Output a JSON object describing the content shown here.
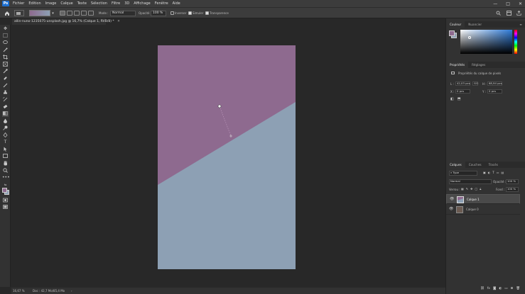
{
  "menubar": {
    "logo": "Ps",
    "items": [
      "Fichier",
      "Edition",
      "Image",
      "Calque",
      "Texte",
      "Sélection",
      "Filtre",
      "3D",
      "Affichage",
      "Fenêtre",
      "Aide"
    ],
    "window_controls": [
      "—",
      "□",
      "✕"
    ]
  },
  "options": {
    "mode_label": "Mode :",
    "mode_value": "Normal",
    "opacity_label": "Opacité :",
    "opacity_value": "100 %",
    "inverse_label": "Inverser",
    "simulate_label": "Simuler",
    "transparency_label": "Transparence"
  },
  "document": {
    "tab_title": "allin-nuno-1235075-unsplash.jpg @ 16,7% (Calque 1, RVB/8) *",
    "gradient_colors": {
      "pink": "#8e6a8f",
      "blue": "#8da0b4"
    }
  },
  "status": {
    "zoom": "16,67 %",
    "doc_size": "Doc : 42,7 Mo/85,4 Mo"
  },
  "color_panel": {
    "tabs": [
      "Couleur",
      "Nuancier"
    ],
    "foreground": "#8e6a8f",
    "background": "#8da0b4"
  },
  "properties_panel": {
    "tabs": [
      "Propriétés",
      "Réglages"
    ],
    "title": "Propriétés du calque de pixels",
    "l_label": "L :",
    "l_value": "42,03 pcs",
    "go_label": "GO",
    "h_label": "H :",
    "h_value": "68,94 pcs",
    "x_label": "X :",
    "x_value": "0 pcs",
    "y_label": "Y :",
    "y_value": "0 pcs"
  },
  "layers_panel": {
    "tabs": [
      "Calques",
      "Couches",
      "Tracés"
    ],
    "filter_label": "Type",
    "blend_mode": "Normal",
    "opacity_label": "Opacité :",
    "opacity_value": "100 %",
    "lock_label": "Verrou :",
    "fill_label": "Fond :",
    "fill_value": "100 %",
    "layers": [
      {
        "name": "Calque 1"
      },
      {
        "name": "Calque 0"
      }
    ]
  }
}
